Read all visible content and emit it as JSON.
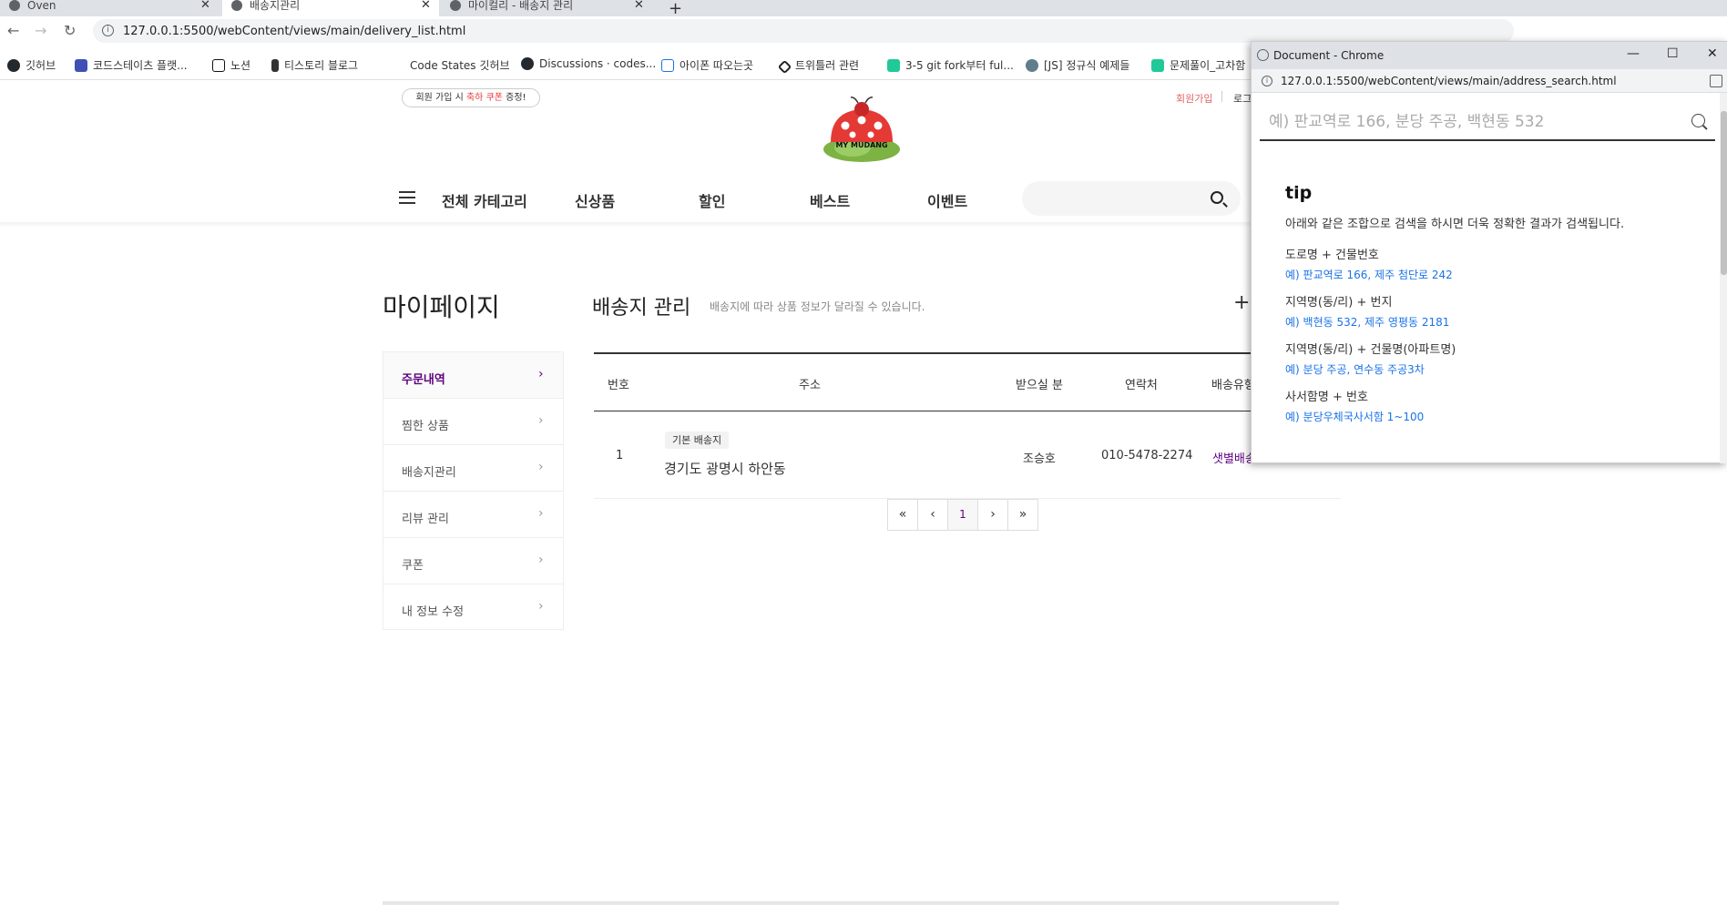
{
  "browser": {
    "tabs": [
      {
        "label": "Oven"
      },
      {
        "label": "배송지관리"
      },
      {
        "label": "마이컬리 - 배송지 관리"
      }
    ],
    "url": "127.0.0.1:5500/webContent/views/main/delivery_list.html",
    "bookmarks": [
      {
        "label": "깃허브"
      },
      {
        "label": "코드스테이츠 플랫..."
      },
      {
        "label": "노션"
      },
      {
        "label": "티스토리 블로그"
      },
      {
        "label": "Code States 깃허브"
      },
      {
        "label": "Discussions · codes..."
      },
      {
        "label": "아이폰 따오는곳"
      },
      {
        "label": "트위틀러 관련"
      },
      {
        "label": "3-5 git fork부터 ful..."
      },
      {
        "label": "[JS] 정규식 예제들"
      },
      {
        "label": "문제풀이_고차함"
      }
    ]
  },
  "header": {
    "promo_prefix": "회원 가입 시 ",
    "promo_highlight": "축하 쿠폰",
    "promo_suffix": " 증정!",
    "join": "회원가입",
    "login": "로그",
    "logo_text": "MY MUDANG",
    "categories": [
      {
        "label": "전체 카테고리"
      },
      {
        "label": "신상품"
      },
      {
        "label": "할인"
      },
      {
        "label": "베스트"
      },
      {
        "label": "이벤트"
      }
    ]
  },
  "mypage": {
    "title": "마이페이지",
    "sidebar": [
      {
        "label": "주문내역",
        "selected": true
      },
      {
        "label": "찜한 상품"
      },
      {
        "label": "배송지관리"
      },
      {
        "label": "리뷰 관리"
      },
      {
        "label": "쿠폰"
      },
      {
        "label": "내 정보 수정"
      }
    ]
  },
  "delivery": {
    "title": "배송지 관리",
    "subtitle": "배송지에 따라 상품 정보가 달라질 수 있습니다.",
    "add_symbol": "+",
    "columns": [
      "번호",
      "주소",
      "받으실 분",
      "연락처",
      "배송유형"
    ],
    "rows": [
      {
        "no": "1",
        "badge": "기본 배송지",
        "address": "경기도 광명시 하안동",
        "recipient": "조승호",
        "phone": "010-5478-2274",
        "type": "샛별배송"
      }
    ],
    "pager": {
      "first": "«",
      "prev": "‹",
      "current": "1",
      "next": "›",
      "last": "»"
    }
  },
  "popup": {
    "window_title": "Document - Chrome",
    "url": "127.0.0.1:5500/webContent/views/main/address_search.html",
    "search_placeholder": "예) 판교역로 166, 분당 주공, 백현동 532",
    "tip_title": "tip",
    "tip_desc": "아래와 같은 조합으로 검색을 하시면 더욱 정확한 결과가 검색됩니다.",
    "tips": [
      {
        "head": "도로명 + 건물번호",
        "example": "예) 판교역로 166,  제주 첨단로 242"
      },
      {
        "head": "지역명(동/리) + 번지",
        "example": "예) 백현동 532,  제주 영평동 2181"
      },
      {
        "head": "지역명(동/리) + 건물명(아파트명)",
        "example": "예) 분당 주공,  연수동 주공3차"
      },
      {
        "head": "사서함명 + 번호",
        "example": "예) 분당우체국사서함 1~100"
      }
    ]
  },
  "colors": {
    "accent": "#5f0080",
    "join": "#e06666",
    "tip_link": "#1a73e8"
  }
}
